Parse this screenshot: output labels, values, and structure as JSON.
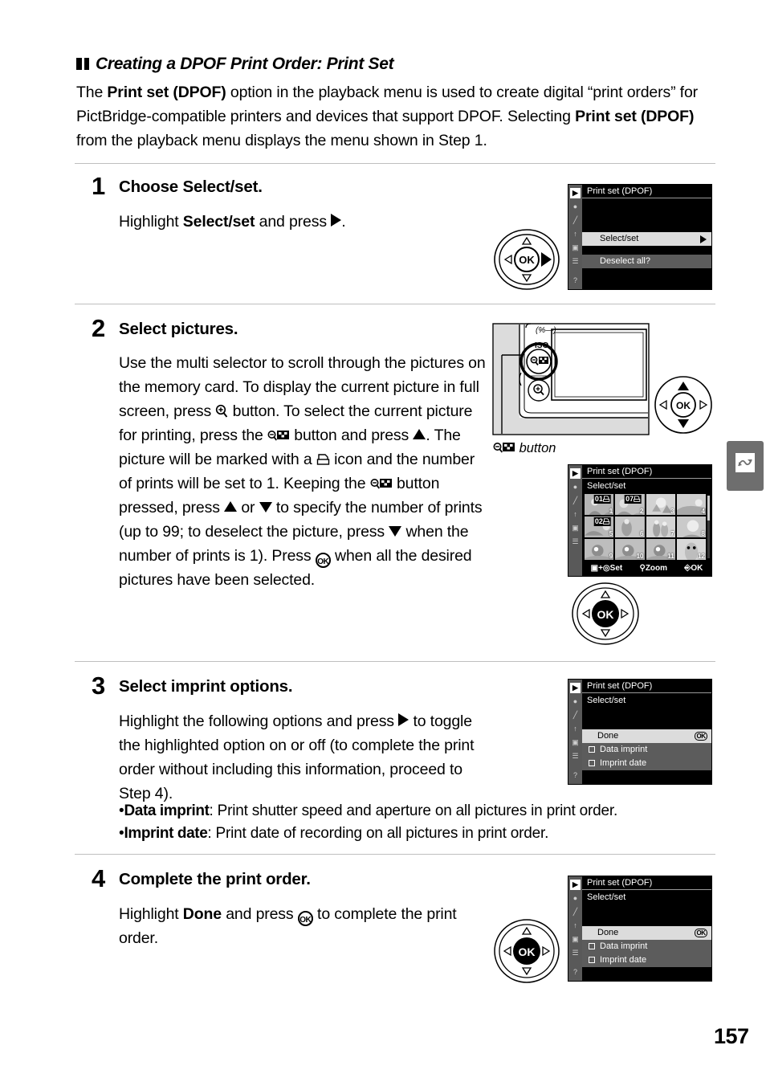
{
  "heading": {
    "title": "Creating a DPOF Print Order: Print Set"
  },
  "intro": {
    "part1": "The ",
    "bold1": "Print set (DPOF)",
    "part2": " option in the playback menu is used to create digital “print orders” for PictBridge-compatible printers and devices that support DPOF.  Selecting ",
    "bold2": "Print set (DPOF)",
    "part3": " from the playback menu displays the menu shown in Step 1."
  },
  "steps": [
    {
      "number": "1",
      "title_prefix": "Choose ",
      "title_bold": "Select/set.",
      "body_part1": "Highlight ",
      "body_bold": "Select/set",
      "body_part2": " and press ",
      "body_part3": "."
    },
    {
      "number": "2",
      "title": "Select pictures.",
      "body_1": "Use the multi selector to scroll through the pictures on the memory card.  To display the current picture in full screen, press ",
      "body_2": " button.  To select the current picture for printing, press the ",
      "body_3": " button and press ",
      "body_4": ".  The picture will be marked with a ",
      "body_5": " icon and the number of prints will be set to 1.  Keeping the ",
      "body_6": " button pressed, press ",
      "body_7": " or ",
      "body_8": " to specify the number of prints (up to 99; to deselect the picture, press ",
      "body_9": " when the number of prints is 1).  Press ",
      "body_10": " when all the desired pictures have been selected."
    },
    {
      "number": "3",
      "title": "Select imprint options.",
      "body_1": "Highlight the following options and press ",
      "body_2": " to toggle the highlighted option on or off (to complete the print order without including this information, proceed to Step 4).",
      "bullet1_label": "Data imprint",
      "bullet1_text": ": Print shutter speed and aperture on all pictures in print order.",
      "bullet2_label": "Imprint date",
      "bullet2_text": ": Print date of recording on all pictures in print order."
    },
    {
      "number": "4",
      "title": "Complete the print order.",
      "body_part1": "Highlight ",
      "body_bold": "Done",
      "body_part2": " and press ",
      "body_part3": " to complete the print order."
    }
  ],
  "camera_diagram": {
    "iso_label": "ISO",
    "lock_label": "%→",
    "caption_text": " button"
  },
  "lcd_screens": {
    "step1": {
      "title": "Print set (DPOF)",
      "rows": [
        {
          "label": "Select/set",
          "style": "highlight",
          "arrow": true
        },
        {
          "label": "Deselect all?",
          "style": "grey",
          "arrow": false
        }
      ],
      "sidebar_icons": [
        "playback-icon",
        "camera-icon",
        "pencil-icon",
        "wrench-icon",
        "retouch-icon",
        "menu-icon",
        "help-icon"
      ]
    },
    "step2": {
      "title": "Print set (DPOF)",
      "subtitle": "Select/set",
      "thumbnails": [
        {
          "index": "1",
          "prints": "01",
          "selected": true,
          "marked": true
        },
        {
          "index": "2",
          "prints": "07",
          "selected": false,
          "marked": true
        },
        {
          "index": "3",
          "prints": "",
          "selected": false,
          "marked": false
        },
        {
          "index": "4",
          "prints": "",
          "selected": false,
          "marked": false
        },
        {
          "index": "5",
          "prints": "02",
          "selected": true,
          "marked": true
        },
        {
          "index": "6",
          "prints": "",
          "selected": false,
          "marked": false
        },
        {
          "index": "7",
          "prints": "",
          "selected": false,
          "marked": false
        },
        {
          "index": "8",
          "prints": "",
          "selected": false,
          "marked": false
        },
        {
          "index": "9",
          "prints": "",
          "selected": false,
          "marked": false
        },
        {
          "index": "10",
          "prints": "",
          "selected": false,
          "marked": false
        },
        {
          "index": "11",
          "prints": "",
          "selected": false,
          "marked": false
        },
        {
          "index": "12",
          "prints": "",
          "selected": false,
          "marked": false
        }
      ],
      "bottom_bar": {
        "set": "Set",
        "zoom": "Zoom",
        "ok": "OK"
      }
    },
    "step3": {
      "title": "Print set (DPOF)",
      "subtitle": "Select/set",
      "rows": [
        {
          "label": "Done",
          "style": "highlight",
          "checkbox": false,
          "ok_badge": "OK"
        },
        {
          "label": "Data imprint",
          "style": "grey",
          "checkbox": true,
          "ok_badge": ""
        },
        {
          "label": "Imprint date",
          "style": "grey",
          "checkbox": true,
          "ok_badge": ""
        }
      ]
    },
    "step4": {
      "title": "Print set (DPOF)",
      "subtitle": "Select/set",
      "rows": [
        {
          "label": "Done",
          "style": "highlight",
          "checkbox": false,
          "ok_badge": "OK"
        },
        {
          "label": "Data imprint",
          "style": "grey",
          "checkbox": true,
          "ok_badge": ""
        },
        {
          "label": "Imprint date",
          "style": "grey",
          "checkbox": true,
          "ok_badge": ""
        }
      ]
    }
  },
  "multi_selector": {
    "ok_label": "OK"
  },
  "chapter_tab": {
    "icon": "retouch-wave-icon"
  },
  "footer": {
    "page_number": "157"
  }
}
